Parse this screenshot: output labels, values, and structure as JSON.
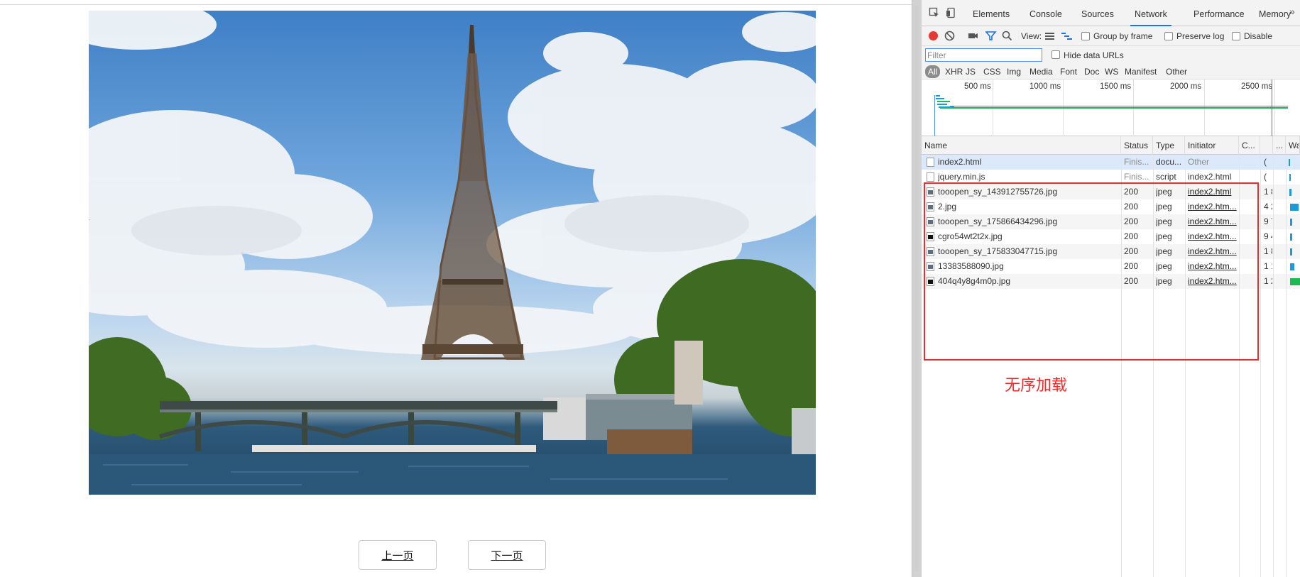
{
  "page": {
    "photo_alt": "Eiffel Tower",
    "prev_label": "上一页",
    "next_label": "下一页"
  },
  "devtools": {
    "tabs": [
      "Elements",
      "Console",
      "Sources",
      "Network",
      "Performance",
      "Memory"
    ],
    "active_tab": "Network",
    "more_icon": "»",
    "toolbar": {
      "view_label": "View:",
      "group_by_frame": "Group by frame",
      "preserve_log": "Preserve log",
      "disable_cache": "Disable"
    },
    "filter": {
      "placeholder": "Filter",
      "hide_data_urls": "Hide data URLs"
    },
    "type_filters": [
      "All",
      "XHR",
      "JS",
      "CSS",
      "Img",
      "Media",
      "Font",
      "Doc",
      "WS",
      "Manifest",
      "Other"
    ],
    "timeline_ticks": [
      "500 ms",
      "1000 ms",
      "1500 ms",
      "2000 ms",
      "2500 ms"
    ],
    "columns": [
      "Name",
      "Status",
      "Type",
      "Initiator",
      "C...",
      "...",
      "Wa"
    ],
    "requests": [
      {
        "name": "index2.html",
        "status": "Finis...",
        "type": "docu...",
        "initiator": "Other",
        "size": "( ",
        "icon": "doc-icon"
      },
      {
        "name": "jquery.min.js",
        "status": "Finis...",
        "type": "script",
        "initiator": "index2.html",
        "size": "( ",
        "icon": "doc-icon"
      },
      {
        "name": "tooopen_sy_143912755726.jpg",
        "status": "200",
        "type": "jpeg",
        "initiator": "index2.html",
        "size": "1 8",
        "icon": "image-icon"
      },
      {
        "name": "2.jpg",
        "status": "200",
        "type": "jpeg",
        "initiator": "index2.htm...",
        "size": "4 2",
        "icon": "image-icon"
      },
      {
        "name": "tooopen_sy_175866434296.jpg",
        "status": "200",
        "type": "jpeg",
        "initiator": "index2.htm...",
        "size": "9 7",
        "icon": "image-icon"
      },
      {
        "name": "cgro54wt2t2x.jpg",
        "status": "200",
        "type": "jpeg",
        "initiator": "index2.htm...",
        "size": "9 4",
        "icon": "image-icon"
      },
      {
        "name": "tooopen_sy_175833047715.jpg",
        "status": "200",
        "type": "jpeg",
        "initiator": "index2.htm...",
        "size": "1 8",
        "icon": "image-icon"
      },
      {
        "name": "13383588090.jpg",
        "status": "200",
        "type": "jpeg",
        "initiator": "index2.htm...",
        "size": "1 1",
        "icon": "image-icon"
      },
      {
        "name": "404q4y8g4m0p.jpg",
        "status": "200",
        "type": "jpeg",
        "initiator": "index2.htm...",
        "size": "1 2",
        "icon": "image-icon"
      }
    ]
  },
  "annotation": {
    "text": "无序加载",
    "color": "#ee2a2a"
  },
  "colors": {
    "accent": "#1a73e8",
    "record": "#e53935",
    "waterfall_green": "#1db954",
    "waterfall_blue": "#1a9bd7"
  }
}
